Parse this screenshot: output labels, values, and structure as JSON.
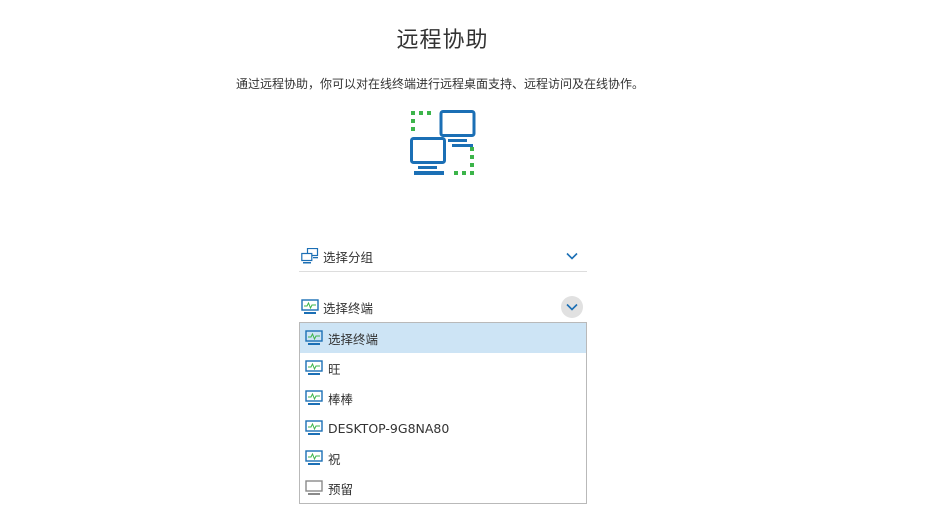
{
  "page": {
    "title": "远程协助",
    "description": "通过远程协助，你可以对在线终端进行远程桌面支持、远程访问及在线协作。"
  },
  "group_select": {
    "icon": "computer-group-icon",
    "label": "选择分组"
  },
  "terminal_select": {
    "icon": "monitor-icon",
    "label": "选择终端",
    "expanded": true
  },
  "terminal_options": [
    {
      "label": "选择终端",
      "icon": "monitor-online-icon",
      "selected": true
    },
    {
      "label": "旺",
      "icon": "monitor-online-icon",
      "selected": false
    },
    {
      "label": "棒棒",
      "icon": "monitor-online-icon",
      "selected": false
    },
    {
      "label": "DESKTOP-9G8NA80",
      "icon": "monitor-online-icon",
      "selected": false
    },
    {
      "label": "祝",
      "icon": "monitor-online-icon",
      "selected": false
    },
    {
      "label": "预留",
      "icon": "monitor-offline-icon",
      "selected": false
    }
  ],
  "colors": {
    "accent_blue": "#1b6fb5",
    "green_dots": "#3cb44a",
    "selected_bg": "#cde4f5",
    "offline_gray": "#8a8a8a"
  }
}
